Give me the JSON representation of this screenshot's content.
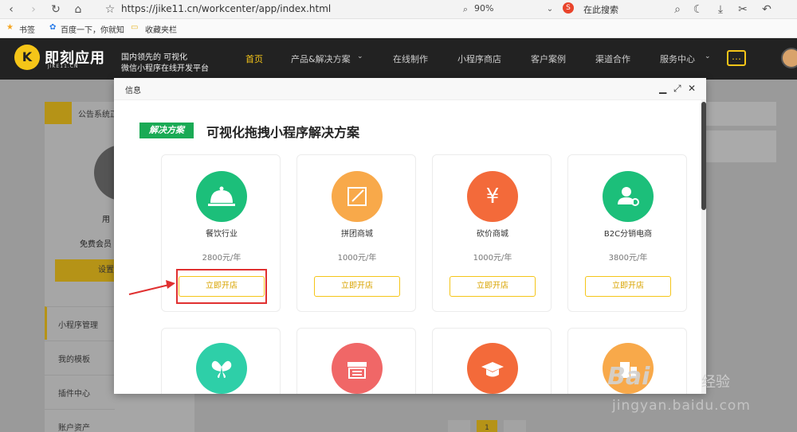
{
  "browser": {
    "url": "https://jike11.cn/workcenter/app/index.html",
    "zoom": "90%",
    "search_placeholder": "在此搜索",
    "search_engine_glyph": "S",
    "bookmarks": [
      "书签",
      "百度一下，你就知",
      "收藏夹栏"
    ]
  },
  "header": {
    "logo_letter": "K",
    "logo_name": "即刻应用",
    "logo_sub": "JIKE11.CN",
    "slogan_line1": "国内领先的 可视化",
    "slogan_line2": "微信小程序在线开发平台",
    "nav": [
      "首页",
      "产品&解决方案",
      "在线制作",
      "小程序商店",
      "客户案例",
      "渠道合作",
      "服务中心"
    ],
    "active_nav": "首页",
    "accent_color": "#f5c518"
  },
  "background_page": {
    "notice": "公告系统正",
    "user_label": "用",
    "member_label": "免费会员",
    "settings_label": "设置",
    "menu": [
      "小程序管理",
      "我的模板",
      "插件中心",
      "账户资产"
    ],
    "page_number": "1"
  },
  "modal": {
    "title": "信息",
    "controls": [
      "minimize-icon",
      "maximize-icon",
      "close-icon"
    ],
    "tag": "解决方案",
    "heading": "可视化拖拽小程序解决方案",
    "cards": [
      {
        "name": "餐饮行业",
        "price": "2800元/年",
        "button": "立即开店",
        "color": "#1cbf7a",
        "icon": "cloche-icon"
      },
      {
        "name": "拼团商城",
        "price": "1000元/年",
        "button": "立即开店",
        "color": "#f8a94a",
        "icon": "edit-frame-icon"
      },
      {
        "name": "砍价商城",
        "price": "1000元/年",
        "button": "立即开店",
        "color": "#f36a3a",
        "icon": "yen-icon"
      },
      {
        "name": "B2C分销电商",
        "price": "3800元/年",
        "button": "立即开店",
        "color": "#1cbf7a",
        "icon": "user-share-icon"
      }
    ],
    "cards_row2": [
      {
        "color": "#2ecfa8",
        "icon": "butterfly-icon"
      },
      {
        "color": "#f06767",
        "icon": "storefront-icon"
      },
      {
        "color": "#f36a3a",
        "icon": "graduation-cap-icon"
      },
      {
        "color": "#f8a94a",
        "icon": "building-icon"
      }
    ]
  },
  "annotation": {
    "highlight_color": "#e03030"
  },
  "watermark": {
    "brand": "Bai",
    "brand_cn": "经验",
    "url": "jingyan.baidu.com"
  }
}
